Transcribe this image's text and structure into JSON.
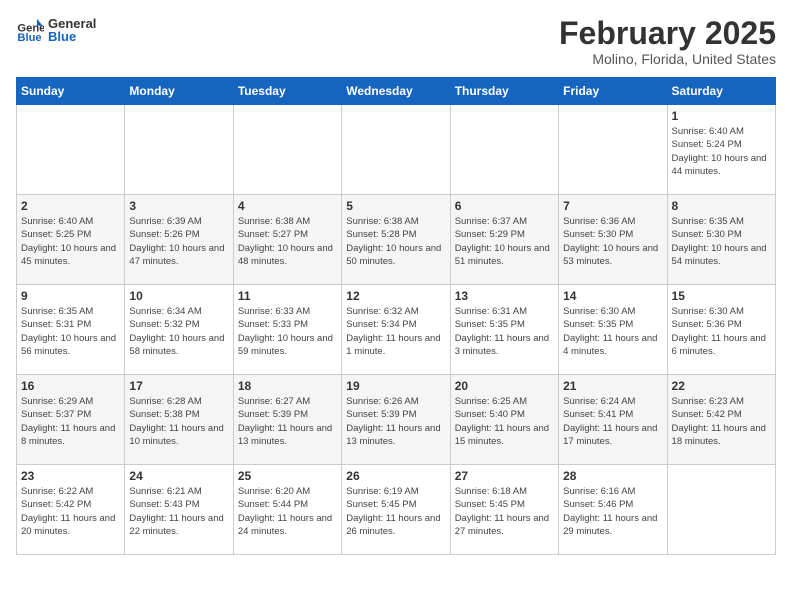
{
  "header": {
    "logo_general": "General",
    "logo_blue": "Blue",
    "month": "February 2025",
    "location": "Molino, Florida, United States"
  },
  "weekdays": [
    "Sunday",
    "Monday",
    "Tuesday",
    "Wednesday",
    "Thursday",
    "Friday",
    "Saturday"
  ],
  "weeks": [
    [
      {
        "day": "",
        "info": ""
      },
      {
        "day": "",
        "info": ""
      },
      {
        "day": "",
        "info": ""
      },
      {
        "day": "",
        "info": ""
      },
      {
        "day": "",
        "info": ""
      },
      {
        "day": "",
        "info": ""
      },
      {
        "day": "1",
        "info": "Sunrise: 6:40 AM\nSunset: 5:24 PM\nDaylight: 10 hours and 44 minutes."
      }
    ],
    [
      {
        "day": "2",
        "info": "Sunrise: 6:40 AM\nSunset: 5:25 PM\nDaylight: 10 hours and 45 minutes."
      },
      {
        "day": "3",
        "info": "Sunrise: 6:39 AM\nSunset: 5:26 PM\nDaylight: 10 hours and 47 minutes."
      },
      {
        "day": "4",
        "info": "Sunrise: 6:38 AM\nSunset: 5:27 PM\nDaylight: 10 hours and 48 minutes."
      },
      {
        "day": "5",
        "info": "Sunrise: 6:38 AM\nSunset: 5:28 PM\nDaylight: 10 hours and 50 minutes."
      },
      {
        "day": "6",
        "info": "Sunrise: 6:37 AM\nSunset: 5:29 PM\nDaylight: 10 hours and 51 minutes."
      },
      {
        "day": "7",
        "info": "Sunrise: 6:36 AM\nSunset: 5:30 PM\nDaylight: 10 hours and 53 minutes."
      },
      {
        "day": "8",
        "info": "Sunrise: 6:35 AM\nSunset: 5:30 PM\nDaylight: 10 hours and 54 minutes."
      }
    ],
    [
      {
        "day": "9",
        "info": "Sunrise: 6:35 AM\nSunset: 5:31 PM\nDaylight: 10 hours and 56 minutes."
      },
      {
        "day": "10",
        "info": "Sunrise: 6:34 AM\nSunset: 5:32 PM\nDaylight: 10 hours and 58 minutes."
      },
      {
        "day": "11",
        "info": "Sunrise: 6:33 AM\nSunset: 5:33 PM\nDaylight: 10 hours and 59 minutes."
      },
      {
        "day": "12",
        "info": "Sunrise: 6:32 AM\nSunset: 5:34 PM\nDaylight: 11 hours and 1 minute."
      },
      {
        "day": "13",
        "info": "Sunrise: 6:31 AM\nSunset: 5:35 PM\nDaylight: 11 hours and 3 minutes."
      },
      {
        "day": "14",
        "info": "Sunrise: 6:30 AM\nSunset: 5:35 PM\nDaylight: 11 hours and 4 minutes."
      },
      {
        "day": "15",
        "info": "Sunrise: 6:30 AM\nSunset: 5:36 PM\nDaylight: 11 hours and 6 minutes."
      }
    ],
    [
      {
        "day": "16",
        "info": "Sunrise: 6:29 AM\nSunset: 5:37 PM\nDaylight: 11 hours and 8 minutes."
      },
      {
        "day": "17",
        "info": "Sunrise: 6:28 AM\nSunset: 5:38 PM\nDaylight: 11 hours and 10 minutes."
      },
      {
        "day": "18",
        "info": "Sunrise: 6:27 AM\nSunset: 5:39 PM\nDaylight: 11 hours and 13 minutes."
      },
      {
        "day": "19",
        "info": "Sunrise: 6:26 AM\nSunset: 5:39 PM\nDaylight: 11 hours and 13 minutes."
      },
      {
        "day": "20",
        "info": "Sunrise: 6:25 AM\nSunset: 5:40 PM\nDaylight: 11 hours and 15 minutes."
      },
      {
        "day": "21",
        "info": "Sunrise: 6:24 AM\nSunset: 5:41 PM\nDaylight: 11 hours and 17 minutes."
      },
      {
        "day": "22",
        "info": "Sunrise: 6:23 AM\nSunset: 5:42 PM\nDaylight: 11 hours and 18 minutes."
      }
    ],
    [
      {
        "day": "23",
        "info": "Sunrise: 6:22 AM\nSunset: 5:42 PM\nDaylight: 11 hours and 20 minutes."
      },
      {
        "day": "24",
        "info": "Sunrise: 6:21 AM\nSunset: 5:43 PM\nDaylight: 11 hours and 22 minutes."
      },
      {
        "day": "25",
        "info": "Sunrise: 6:20 AM\nSunset: 5:44 PM\nDaylight: 11 hours and 24 minutes."
      },
      {
        "day": "26",
        "info": "Sunrise: 6:19 AM\nSunset: 5:45 PM\nDaylight: 11 hours and 26 minutes."
      },
      {
        "day": "27",
        "info": "Sunrise: 6:18 AM\nSunset: 5:45 PM\nDaylight: 11 hours and 27 minutes."
      },
      {
        "day": "28",
        "info": "Sunrise: 6:16 AM\nSunset: 5:46 PM\nDaylight: 11 hours and 29 minutes."
      },
      {
        "day": "",
        "info": ""
      }
    ]
  ]
}
